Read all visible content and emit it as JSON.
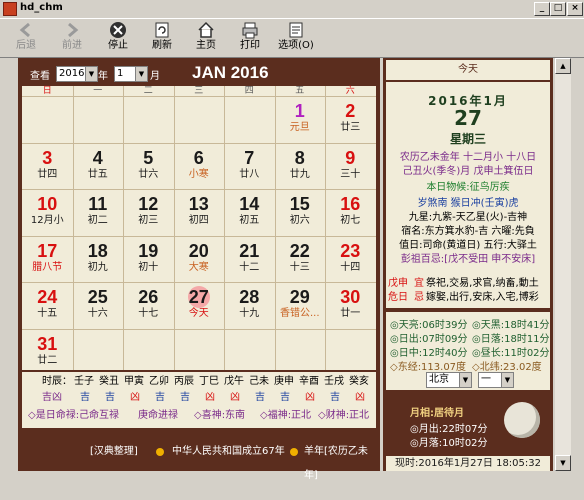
{
  "window": {
    "title": "hd_chm"
  },
  "toolbar": {
    "back": "后退",
    "forward": "前进",
    "stop": "停止",
    "refresh": "刷新",
    "home": "主页",
    "print": "打印",
    "options": "选项(O)"
  },
  "calendar": {
    "view_label": "查看",
    "year": "2016",
    "year_suffix": "年",
    "month": "1",
    "month_suffix": "月",
    "heading": "JAN 2016",
    "weekdays": [
      "日",
      "一",
      "二",
      "三",
      "四",
      "五",
      "六"
    ],
    "days": [
      {
        "d": "1",
        "l": "元旦",
        "col": 5,
        "row": 0,
        "hol": true
      },
      {
        "d": "2",
        "l": "廿三",
        "col": 6,
        "row": 0,
        "wk": true
      },
      {
        "d": "3",
        "l": "廿四",
        "col": 0,
        "row": 1,
        "wk": true
      },
      {
        "d": "4",
        "l": "廿五",
        "col": 1,
        "row": 1
      },
      {
        "d": "5",
        "l": "廿六",
        "col": 2,
        "row": 1
      },
      {
        "d": "6",
        "l": "小寒",
        "col": 3,
        "row": 1,
        "term": true
      },
      {
        "d": "7",
        "l": "廿八",
        "col": 4,
        "row": 1
      },
      {
        "d": "8",
        "l": "廿九",
        "col": 5,
        "row": 1
      },
      {
        "d": "9",
        "l": "三十",
        "col": 6,
        "row": 1,
        "wk": true
      },
      {
        "d": "10",
        "l": "12月小",
        "col": 0,
        "row": 2,
        "wk": true
      },
      {
        "d": "11",
        "l": "初二",
        "col": 1,
        "row": 2
      },
      {
        "d": "12",
        "l": "初三",
        "col": 2,
        "row": 2
      },
      {
        "d": "13",
        "l": "初四",
        "col": 3,
        "row": 2
      },
      {
        "d": "14",
        "l": "初五",
        "col": 4,
        "row": 2
      },
      {
        "d": "15",
        "l": "初六",
        "col": 5,
        "row": 2
      },
      {
        "d": "16",
        "l": "初七",
        "col": 6,
        "row": 2,
        "wk": true
      },
      {
        "d": "17",
        "l": "腊八节",
        "col": 0,
        "row": 3,
        "wk": true,
        "hol": true
      },
      {
        "d": "18",
        "l": "初九",
        "col": 1,
        "row": 3
      },
      {
        "d": "19",
        "l": "初十",
        "col": 2,
        "row": 3
      },
      {
        "d": "20",
        "l": "大寒",
        "col": 3,
        "row": 3,
        "term": true
      },
      {
        "d": "21",
        "l": "十二",
        "col": 4,
        "row": 3
      },
      {
        "d": "22",
        "l": "十三",
        "col": 5,
        "row": 3
      },
      {
        "d": "23",
        "l": "十四",
        "col": 6,
        "row": 3,
        "wk": true
      },
      {
        "d": "24",
        "l": "十五",
        "col": 0,
        "row": 4,
        "wk": true
      },
      {
        "d": "25",
        "l": "十六",
        "col": 1,
        "row": 4
      },
      {
        "d": "26",
        "l": "十七",
        "col": 2,
        "row": 4
      },
      {
        "d": "27",
        "l": "今天",
        "col": 3,
        "row": 4,
        "today": true
      },
      {
        "d": "28",
        "l": "十九",
        "col": 4,
        "row": 4
      },
      {
        "d": "29",
        "l": "香错公...",
        "col": 5,
        "row": 4,
        "term": true
      },
      {
        "d": "30",
        "l": "廿一",
        "col": 6,
        "row": 4,
        "wk": true
      },
      {
        "d": "31",
        "l": "廿二",
        "col": 0,
        "row": 5,
        "wk": true
      }
    ]
  },
  "info": {
    "hours_label": "时辰：",
    "hours": [
      "壬子",
      "癸丑",
      "甲寅",
      "乙卯",
      "丙辰",
      "丁巳",
      "戊午",
      "己未",
      "庚申",
      "辛酉",
      "壬戌",
      "癸亥"
    ],
    "jixiong_label": "吉凶",
    "jixiong": [
      "吉",
      "吉",
      "凶",
      "吉",
      "吉",
      "凶",
      "凶",
      "吉",
      "吉",
      "凶",
      "吉",
      "凶"
    ],
    "gods": [
      "◇是日命禄:己命互禄",
      "庚命进禄",
      "◇喜神:东南",
      "◇福神:正北",
      "◇财神:正北"
    ]
  },
  "footer": {
    "text1": "[汉典整理]",
    "text2": "中华人民共和国成立67年",
    "text3": "羊年[农历乙未年]"
  },
  "today": {
    "header": "今天",
    "ym": "2016年1月",
    "day": "27",
    "weekday": "星期三",
    "lunar1": "农历乙未金年 十二月小 十八日",
    "lunar2": "己丑火(季冬)月 戊申土箕伍日",
    "wuhou": "本日物候:征鸟厉疾",
    "chong": "岁煞南 猴日冲(壬寅)虎",
    "star1": "九星:九紫-天乙星(火)-吉神",
    "star2": "宿名:东方箕水豹-吉 六曜:先負",
    "star3": "值日:司命(黄道日) 五行:大驿土",
    "pengzu": "彭祖百忌:[戊不受田 申不安床]"
  },
  "almanac": {
    "yi_label": "宜",
    "yi": "祭祀,交易,求官,纳畜,動土",
    "ji_label": "忌",
    "ji": "嫁娶,出行,安床,入宅,博彩",
    "side1": "戊申",
    "side2": "危日"
  },
  "sun": {
    "dawn": "◎天亮:06时39分",
    "rise": "◎日出:07时09分",
    "noon": "◎日中:12时40分",
    "dusk": "◎天黑:18时41分",
    "set": "◎日落:18时11分",
    "daylen": "◎昼长:11时02分",
    "lng": "◇东经:113.07度",
    "lat": "◇北纬:23.02度",
    "city": "北京",
    "dist": "一"
  },
  "moon": {
    "phase": "月相:居待月",
    "rise": "◎月出:22时07分",
    "set": "◎月落:10时02分"
  },
  "now": "现时:2016年1月27日 18:05:32",
  "colors": {
    "maroon": "#5b2d1e",
    "panel": "#f1ecd9",
    "red": "#d81010",
    "green": "#1f5f2f",
    "purple": "#7a2a8a"
  }
}
